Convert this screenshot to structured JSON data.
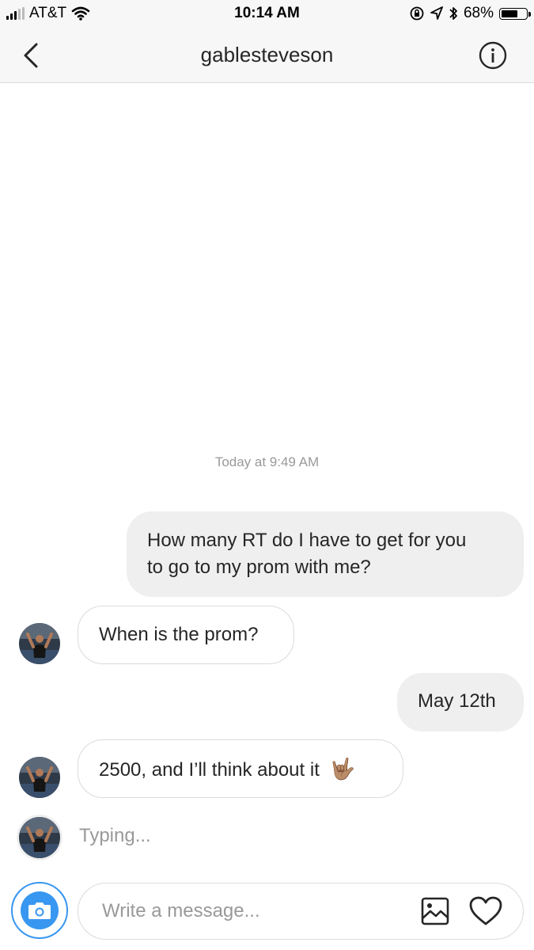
{
  "status_bar": {
    "carrier": "AT&T",
    "time": "10:14 AM",
    "battery": "68%",
    "battery_level": 0.68,
    "icons": [
      "signal-icon",
      "wifi-icon",
      "rotation-lock-icon",
      "location-icon",
      "bluetooth-icon",
      "battery-icon"
    ]
  },
  "header": {
    "title": "gablesteveson",
    "back_icon": "chevron-left-icon",
    "info_icon": "info-icon"
  },
  "conversation": {
    "timestamp": "Today at 9:49 AM",
    "messages": [
      {
        "sender": "me",
        "text_line1": "How many RT do I have to get for you",
        "text_line2": "to go to my prom with me?"
      },
      {
        "sender": "them",
        "text": "When is the prom?"
      },
      {
        "sender": "me",
        "text": "May 12th"
      },
      {
        "sender": "them",
        "text": "2500, and I’ll think about it",
        "emoji": "🤟🏽"
      }
    ],
    "typing": "Typing..."
  },
  "composer": {
    "placeholder": "Write a message...",
    "camera_icon": "camera-icon",
    "gallery_icon": "image-icon",
    "like_icon": "heart-icon"
  },
  "colors": {
    "accent": "#3897f0",
    "outgoing_bubble": "#efefef",
    "border": "#dbdbdb",
    "secondary_text": "#999999"
  }
}
